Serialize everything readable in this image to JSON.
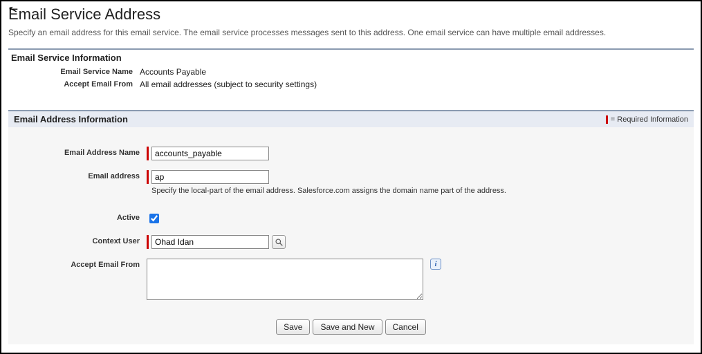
{
  "page": {
    "title": "Email Service Address",
    "description": "Specify an email address for this email service. The email service processes messages sent to this address. One email service can have multiple email addresses."
  },
  "section1": {
    "title": "Email Service Information",
    "rows": {
      "service_name_label": "Email Service Name",
      "service_name_value": "Accounts Payable",
      "accept_from_label": "Accept Email From",
      "accept_from_value": "All email addresses (subject to security settings)"
    }
  },
  "section2": {
    "title": "Email Address Information",
    "required_legend": "= Required Information",
    "fields": {
      "email_address_name": {
        "label": "Email Address Name",
        "value": "accounts_payable"
      },
      "email_address": {
        "label": "Email address",
        "value": "ap",
        "help": "Specify the local-part of the email address. Salesforce.com assigns the domain name part of the address."
      },
      "active": {
        "label": "Active",
        "checked": true
      },
      "context_user": {
        "label": "Context User",
        "value": "Ohad Idan"
      },
      "accept_email_from": {
        "label": "Accept Email From",
        "value": ""
      }
    }
  },
  "buttons": {
    "save": "Save",
    "save_and_new": "Save and New",
    "cancel": "Cancel"
  }
}
